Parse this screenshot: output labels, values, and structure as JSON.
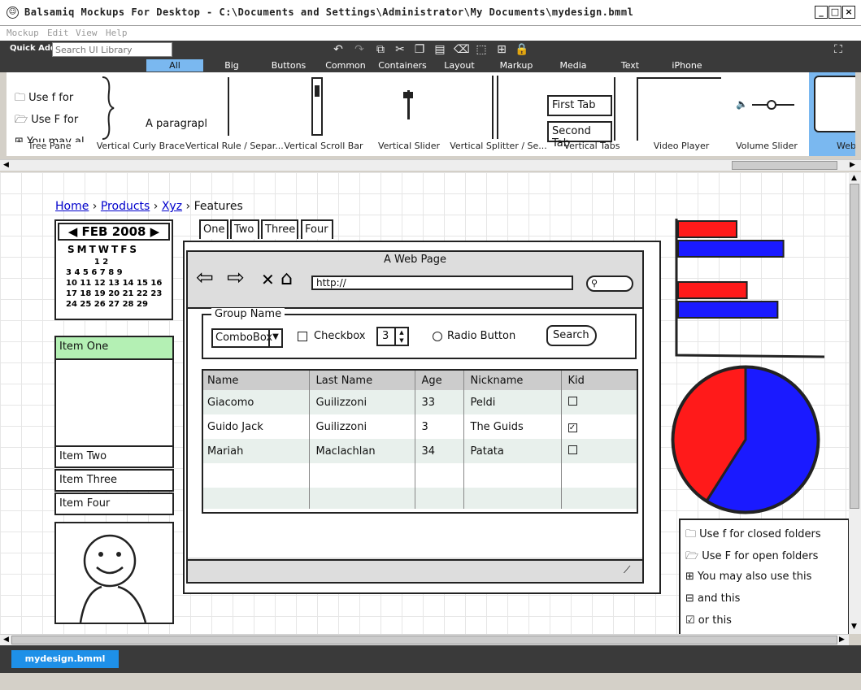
{
  "window": {
    "title": "Balsamiq Mockups For Desktop - C:\\Documents and Settings\\Administrator\\My Documents\\mydesign.bmml",
    "min": "_",
    "max": "□",
    "close": "×"
  },
  "menu": [
    "Mockup",
    "Edit",
    "View",
    "Help"
  ],
  "quick_add": {
    "label": "Quick Add:",
    "placeholder": "Search UI Library"
  },
  "categories": [
    "All",
    "Big",
    "Buttons",
    "Common",
    "Containers",
    "Layout",
    "Markup",
    "Media",
    "Text",
    "iPhone"
  ],
  "library": [
    {
      "name": "Tree Pane",
      "lines": [
        "Use f for",
        "Use F for",
        "You may al"
      ]
    },
    {
      "name": "Vertical Curly Brace"
    },
    {
      "name": "Vertical Rule / Separ...",
      "text": "A paragrapl"
    },
    {
      "name": "Vertical Scroll Bar"
    },
    {
      "name": "Vertical Slider"
    },
    {
      "name": "Vertical Splitter / Se..."
    },
    {
      "name": "Vertical Tabs",
      "tabs": [
        "First Tab",
        "Second Tab"
      ]
    },
    {
      "name": "Video Player"
    },
    {
      "name": "Volume Slider"
    },
    {
      "name": "Web"
    }
  ],
  "mockup": {
    "breadcrumb": [
      "Home",
      "Products",
      "Xyz",
      "Features"
    ],
    "calendar": {
      "month": "FEB 2008",
      "days": "SMTWTFS",
      "rows": [
        "          1 2",
        "3 4 5 6 7 8 9",
        "10 11 12 13 14 15 16",
        "17 18 19 20 21 22 23",
        "24 25 26 27 28 29"
      ]
    },
    "list": [
      "Item One",
      "Item Two",
      "Item Three",
      "Item Four"
    ],
    "tabs": [
      "One",
      "Two",
      "Three",
      "Four"
    ],
    "browser": {
      "title": "A Web Page",
      "url": "http://"
    },
    "group": {
      "title": "Group Name",
      "combo": "ComboBox",
      "checkbox": "Checkbox",
      "stepper": "3",
      "radio": "Radio Button",
      "search": "Search"
    },
    "table": {
      "headers": [
        "Name",
        "Last Name",
        "Age",
        "Nickname",
        "Kid"
      ],
      "rows": [
        [
          "Giacomo",
          "Guilizzoni",
          "33",
          "Peldi",
          false
        ],
        [
          "Guido Jack",
          "Guilizzoni",
          "3",
          "The Guids",
          true
        ],
        [
          "Mariah",
          "Maclachlan",
          "34",
          "Patata",
          false
        ]
      ]
    },
    "tree": [
      "Use f for closed folders",
      "Use F for open folders",
      "You may also use this",
      "and this",
      "or this"
    ]
  },
  "doc_tab": "mydesign.bmml",
  "colors": {
    "red": "#ff1a1a",
    "blue": "#1a1aff",
    "selection": "#7ab8f0",
    "highlight": "#b4f0b4"
  },
  "chart_data": [
    {
      "type": "bar",
      "orientation": "horizontal",
      "series": [
        {
          "values": [
            0.4,
            0.72
          ]
        },
        {
          "values": [
            0.47,
            0.68
          ]
        }
      ],
      "xlim": [
        0,
        1
      ]
    },
    {
      "type": "pie",
      "values": [
        41,
        59
      ],
      "colors": [
        "#ff1a1a",
        "#1a1aff"
      ]
    }
  ]
}
